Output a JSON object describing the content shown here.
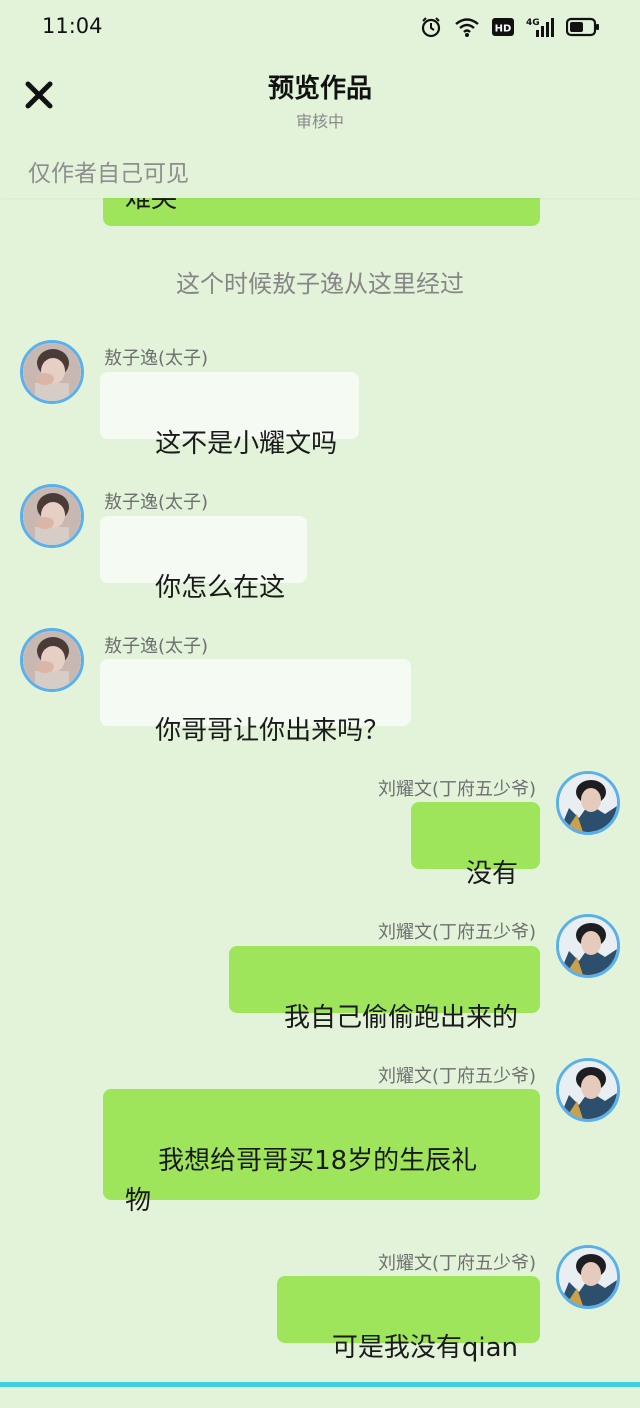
{
  "status_bar": {
    "time": "11:04",
    "icons": [
      "alarm-icon",
      "wifi-icon",
      "hd-icon",
      "signal-4g-icon",
      "battery-icon"
    ],
    "network": "4G",
    "hd": "HD"
  },
  "header": {
    "title": "预览作品",
    "subtitle": "审核中",
    "close_icon": "close-icon"
  },
  "visibility_note": "仅作者自己可见",
  "partial_message": {
    "text": "难哭"
  },
  "narration": "这个时候敖子逸从这里经过",
  "characters": {
    "left": {
      "name": "敖子逸(太子)",
      "avatar_icon": "avatar-aozi-icon"
    },
    "right": {
      "name": "刘耀文(丁府五少爷)",
      "avatar_icon": "avatar-liuyaowen-icon"
    }
  },
  "messages": [
    {
      "side": "left",
      "name": "敖子逸(太子)",
      "text": "这不是小耀文吗"
    },
    {
      "side": "left",
      "name": "敖子逸(太子)",
      "text": "你怎么在这"
    },
    {
      "side": "left",
      "name": "敖子逸(太子)",
      "text": "你哥哥让你出来吗？"
    },
    {
      "side": "right",
      "name": "刘耀文(丁府五少爷)",
      "text": "没有"
    },
    {
      "side": "right",
      "name": "刘耀文(丁府五少爷)",
      "text": "我自己偷偷跑出来的"
    },
    {
      "side": "right",
      "name": "刘耀文(丁府五少爷)",
      "text": "我想给哥哥买18岁的生辰礼\n物"
    },
    {
      "side": "right",
      "name": "刘耀文(丁府五少爷)",
      "text": "可是我没有qian"
    }
  ],
  "colors": {
    "background": "#e3f3da",
    "left_bubble": "#f5fbf2",
    "right_bubble": "#9fe55c",
    "avatar_ring": "#5ab0ea",
    "bottom_line": "#3dd0e0"
  }
}
